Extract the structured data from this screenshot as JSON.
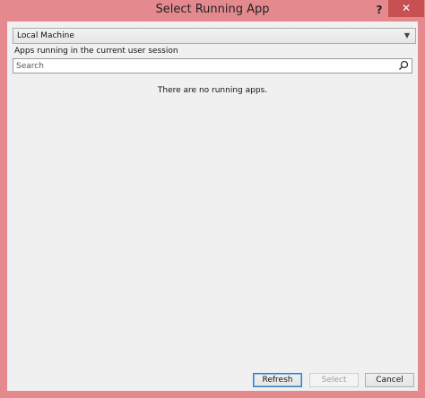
{
  "window": {
    "title": "Select Running App",
    "help_label": "?",
    "close_label": "✕"
  },
  "machine": {
    "selected": "Local Machine"
  },
  "apps": {
    "section_label": "Apps running in the current user session",
    "empty_message": "There are no running apps."
  },
  "search": {
    "placeholder": "Search",
    "value": ""
  },
  "buttons": {
    "refresh": "Refresh",
    "select": "Select",
    "cancel": "Cancel"
  },
  "colors": {
    "window_frame": "#e48a8e",
    "close_button": "#c75050",
    "client_background": "#f0f0f0"
  }
}
